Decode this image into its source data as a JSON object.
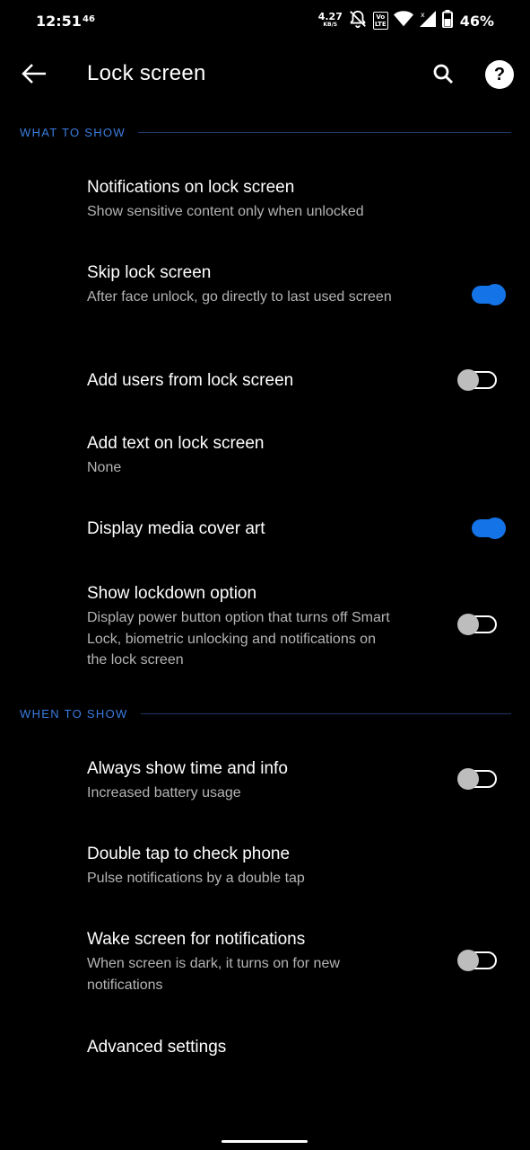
{
  "status_bar": {
    "time": "12:51",
    "extra": "46",
    "speed_value": "4.27",
    "speed_unit": "KB/S",
    "volte_top": "Vo",
    "volte_bottom": "LTE",
    "battery": "46%"
  },
  "app_bar": {
    "title": "Lock screen"
  },
  "sections": [
    {
      "header": "WHAT TO SHOW",
      "items": [
        {
          "title": "Notifications on lock screen",
          "subtitle": "Show sensitive content only when unlocked"
        },
        {
          "title": "Skip lock screen",
          "subtitle": "After face unlock, go directly to last used screen",
          "toggle": true
        },
        {
          "title": "Add users from lock screen",
          "toggle": false
        },
        {
          "title": "Add text on lock screen",
          "subtitle": "None"
        },
        {
          "title": "Display media cover art",
          "toggle": true
        },
        {
          "title": "Show lockdown option",
          "subtitle": "Display power button option that turns off Smart Lock, biometric unlocking and notifications on the lock screen",
          "toggle": false
        }
      ]
    },
    {
      "header": "WHEN TO SHOW",
      "items": [
        {
          "title": "Always show time and info",
          "subtitle": "Increased battery usage",
          "toggle": false
        },
        {
          "title": "Double tap to check phone",
          "subtitle": "Pulse notifications by a double tap"
        },
        {
          "title": "Wake screen for notifications",
          "subtitle": "When screen is dark, it turns on for new notifications",
          "toggle": false
        },
        {
          "title": "Advanced settings"
        }
      ]
    }
  ],
  "colors": {
    "accent": "#1473e6",
    "section_header": "#3b7de0",
    "background": "#000000"
  },
  "icons": {
    "back": "arrow-back-icon",
    "search": "search-icon",
    "help": "help-icon"
  }
}
